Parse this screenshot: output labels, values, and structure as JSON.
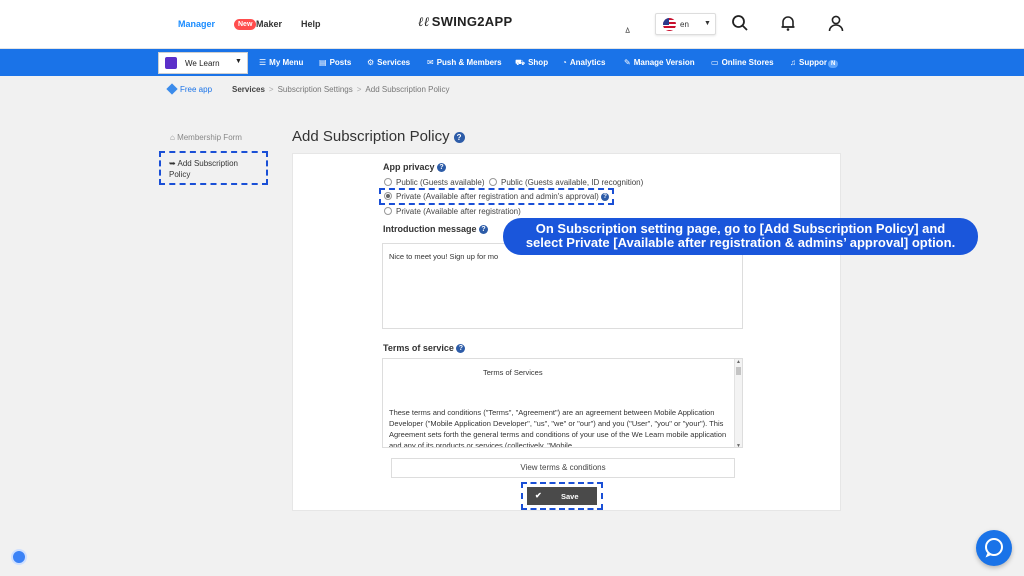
{
  "header": {
    "nav": [
      "Manager",
      "Maker",
      "Help"
    ],
    "new_badge": "New",
    "logo": "SWING2APP",
    "logo_mark": "ㅿ",
    "language": "en"
  },
  "navbar": {
    "app_name": "We Learn",
    "items": [
      {
        "icon": "menu-icon",
        "label": "My Menu"
      },
      {
        "icon": "posts-icon",
        "label": "Posts"
      },
      {
        "icon": "gear-icon",
        "label": "Services"
      },
      {
        "icon": "mail-icon",
        "label": "Push & Members"
      },
      {
        "icon": "cart-icon",
        "label": "Shop"
      },
      {
        "icon": "chart-icon",
        "label": "Analytics"
      },
      {
        "icon": "wrench-icon",
        "label": "Manage Version"
      },
      {
        "icon": "store-icon",
        "label": "Online Stores"
      },
      {
        "icon": "headset-icon",
        "label": "Suppor"
      }
    ],
    "support_badge": "N",
    "accent": "#1a73e8"
  },
  "breadcrumb": {
    "free_app": "Free app",
    "items": [
      "Services",
      "Subscription Settings",
      "Add Subscription Policy"
    ]
  },
  "sidebar": {
    "items": [
      "Membership Form",
      "Add Subscription Policy"
    ]
  },
  "page": {
    "title": "Add Subscription Policy",
    "app_privacy": {
      "label": "App privacy",
      "options": [
        "Public (Guests available)",
        "Public (Guests available, ID recognition)",
        "Private (Available after registration and admin's approval)",
        "Private (Available after registration)"
      ],
      "selected": "Private (Available after registration and admin's approval)"
    },
    "intro": {
      "label": "Introduction message",
      "value": "Nice to meet you! Sign up for mo"
    },
    "terms": {
      "label": "Terms of service",
      "title": "Terms of Services",
      "body": "These terms and conditions (\"Terms\", \"Agreement\") are an agreement between Mobile Application Developer (\"Mobile Application Developer\", \"us\", \"we\" or \"our\") and you (\"User\", \"you\" or \"your\"). This Agreement sets forth the general terms and conditions of your use of the We Learn mobile application and any of its products or services (collectively, \"Mobile"
    },
    "view_terms": "View terms & conditions",
    "save": "Save"
  },
  "callout": {
    "line1": "On Subscription setting page, go to [Add Subscription  Policy] and",
    "line2": "select Private [Available after registration & admins’ approval] option."
  }
}
